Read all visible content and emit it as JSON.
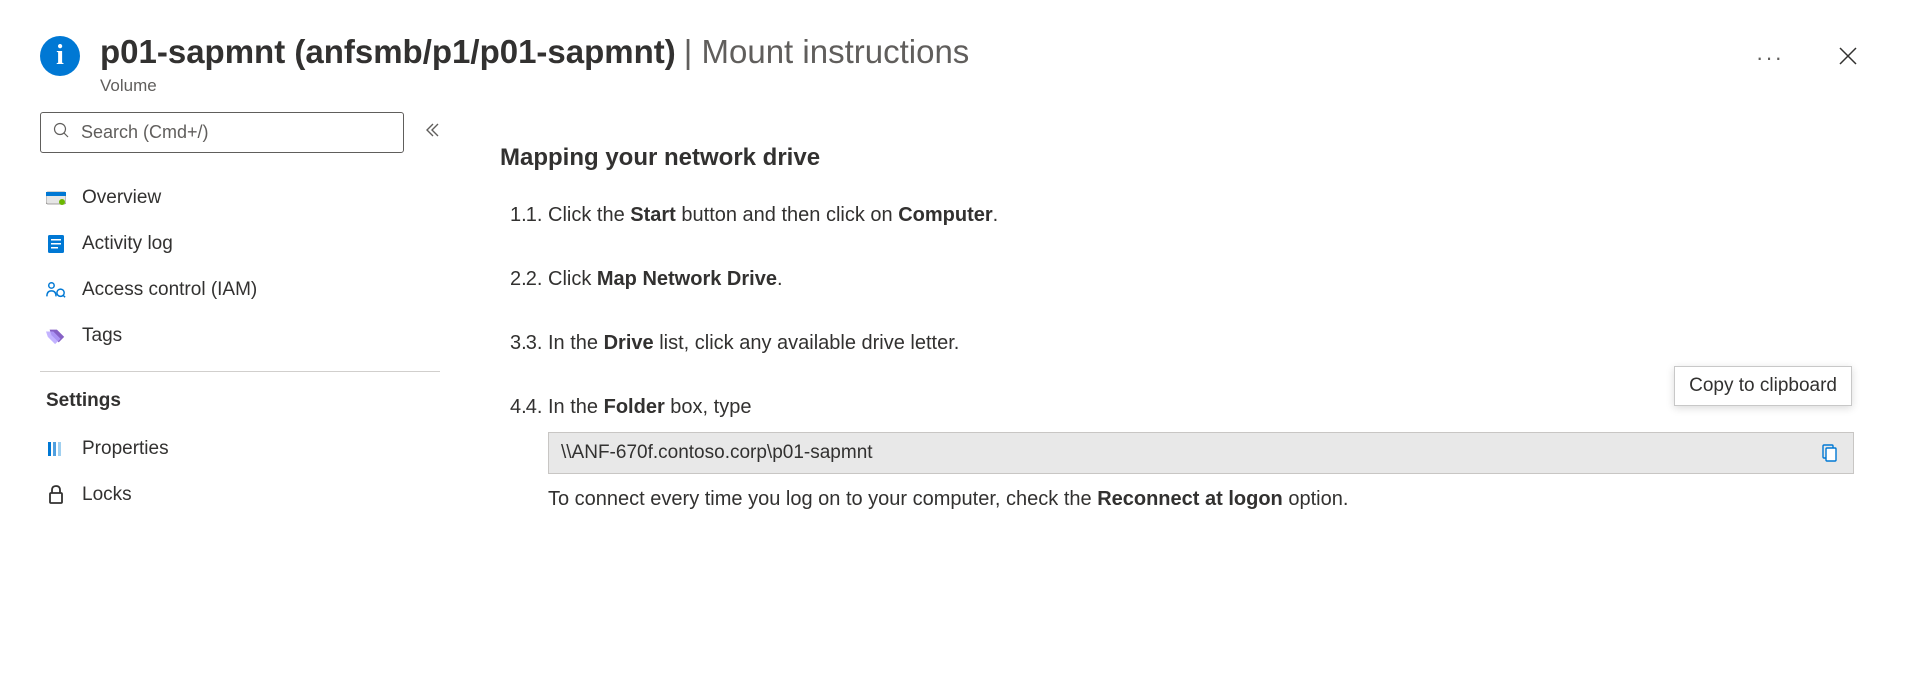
{
  "header": {
    "title_bold": "p01-sapmnt (anfsmb/p1/p01-sapmnt)",
    "title_light": "| Mount instructions",
    "subtitle": "Volume",
    "more": "···"
  },
  "sidebar": {
    "search_placeholder": "Search (Cmd+/)",
    "items": [
      {
        "label": "Overview"
      },
      {
        "label": "Activity log"
      },
      {
        "label": "Access control (IAM)"
      },
      {
        "label": "Tags"
      }
    ],
    "settings_title": "Settings",
    "settings_items": [
      {
        "label": "Properties"
      },
      {
        "label": "Locks"
      }
    ]
  },
  "content": {
    "heading": "Mapping your network drive",
    "steps": {
      "s1": {
        "pre": "Click the ",
        "b1": "Start",
        "mid": " button and then click on ",
        "b2": "Computer",
        "post": "."
      },
      "s2": {
        "pre": "Click ",
        "b1": "Map Network Drive",
        "post": "."
      },
      "s3": {
        "pre": "In the ",
        "b1": "Drive",
        "post": " list, click any available drive letter."
      },
      "s4": {
        "pre": "In the ",
        "b1": "Folder",
        "post": " box, type"
      },
      "path": "\\\\ANF-670f.contoso.corp\\p01-sapmnt",
      "followup": {
        "pre": "To connect every time you log on to your computer, check the ",
        "b1": "Reconnect at logon",
        "post": " option."
      }
    },
    "tooltip": "Copy to clipboard"
  }
}
